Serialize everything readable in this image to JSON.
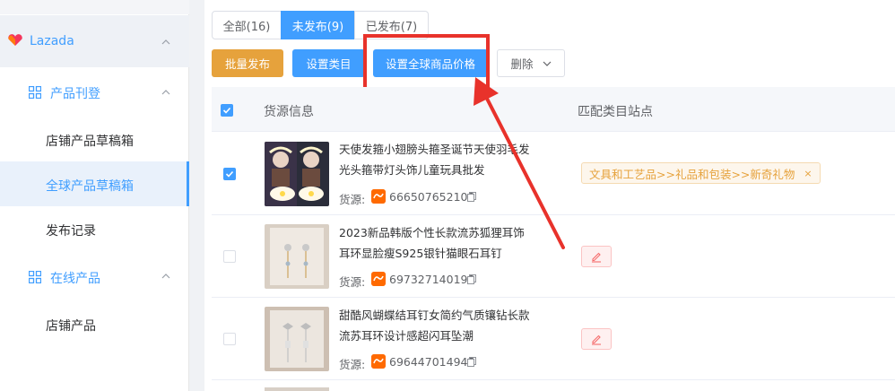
{
  "sidebar": {
    "platform": "Lazada",
    "groups": [
      {
        "label": "产品刊登",
        "items": [
          "店铺产品草稿箱",
          "全球产品草稿箱",
          "发布记录"
        ]
      },
      {
        "label": "在线产品",
        "items": [
          "店铺产品"
        ]
      }
    ],
    "active_item": "全球产品草稿箱"
  },
  "tabs": [
    "全部(16)",
    "未发布(9)",
    "已发布(7)"
  ],
  "active_tab": "未发布(9)",
  "toolbar": {
    "batch_publish": "批量发布",
    "set_category": "设置类目",
    "set_global_price": "设置全球商品价格",
    "delete": "删除"
  },
  "table": {
    "headers": [
      "货源信息",
      "匹配类目站点"
    ],
    "rows": [
      {
        "checked": true,
        "title_line1": "天使发箍小翅膀头箍圣诞节天使羽毛发",
        "title_line2": "光头箍带灯头饰儿童玩具批发",
        "source_label": "货源:",
        "source_id": "666507652108",
        "category_tag": "文具和工艺品>>礼品和包装>>新奇礼物",
        "tag_close": "×"
      },
      {
        "checked": false,
        "title_line1": "2023新品韩版个性长款流苏狐狸耳饰",
        "title_line2": "耳环显脸瘦S925银针猫眼石耳钉",
        "source_label": "货源:",
        "source_id": "697327140198"
      },
      {
        "checked": false,
        "title_line1": "甜酷风蝴蝶结耳钉女简约气质镶钻长款",
        "title_line2": "流苏耳环设计感超闪耳坠潮",
        "source_label": "货源:",
        "source_id": "696447014945"
      }
    ]
  },
  "colors": {
    "primary": "#409eff",
    "warning": "#e6a23c",
    "highlight": "#e8322b"
  }
}
